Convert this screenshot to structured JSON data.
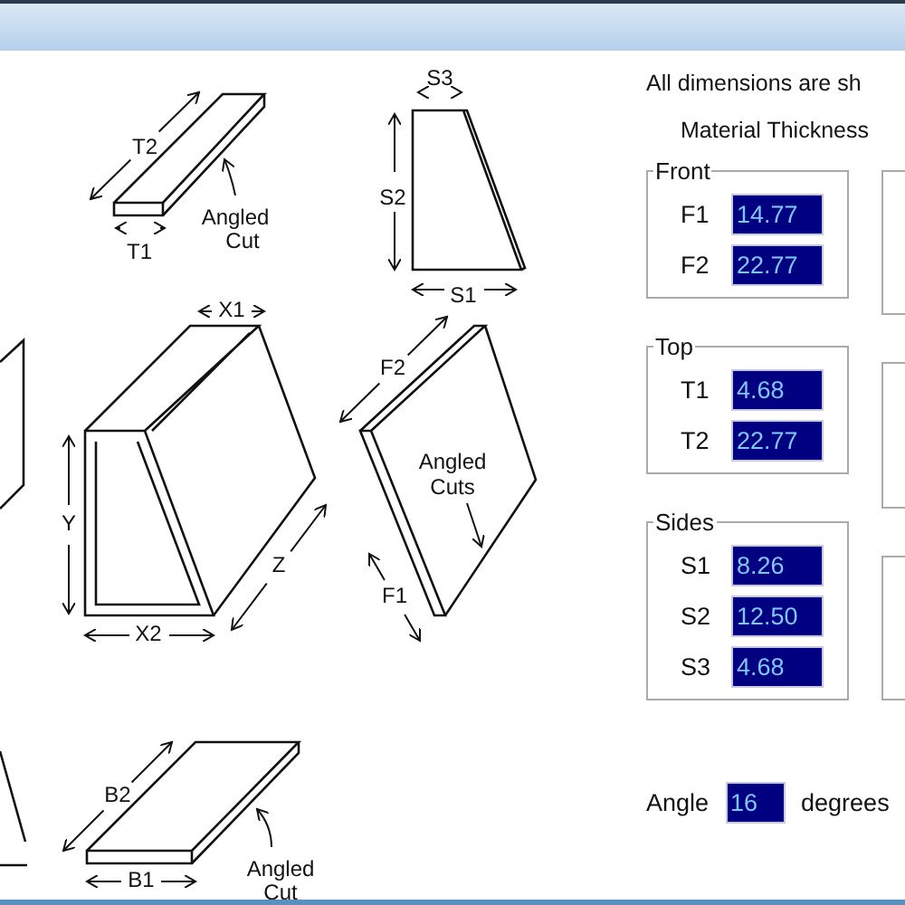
{
  "diagram": {
    "labels": [
      {
        "text": "T2"
      },
      {
        "text": "T1"
      },
      {
        "text": "Angled"
      },
      {
        "text": "Cut"
      },
      {
        "text": "S3"
      },
      {
        "text": "S2"
      },
      {
        "text": "S1"
      },
      {
        "text": "X1"
      },
      {
        "text": "Y"
      },
      {
        "text": "Z"
      },
      {
        "text": "X2"
      },
      {
        "text": "F2"
      },
      {
        "text": "Angled"
      },
      {
        "text": "Cuts"
      },
      {
        "text": "F1"
      },
      {
        "text": "B2"
      },
      {
        "text": "B1"
      },
      {
        "text": "Angled"
      },
      {
        "text": "Cut"
      }
    ]
  },
  "panel": {
    "note": "All dimensions are sh",
    "subheading": "Material Thickness",
    "groups": [
      {
        "title": "Front",
        "fields": [
          {
            "label": "F1",
            "value": "14.77"
          },
          {
            "label": "F2",
            "value": "22.77"
          }
        ]
      },
      {
        "title": "Top",
        "fields": [
          {
            "label": "T1",
            "value": "4.68"
          },
          {
            "label": "T2",
            "value": "22.77"
          }
        ]
      },
      {
        "title": "Sides",
        "fields": [
          {
            "label": "S1",
            "value": "8.26"
          },
          {
            "label": "S2",
            "value": "12.50"
          },
          {
            "label": "S3",
            "value": "4.68"
          }
        ]
      }
    ],
    "angle": {
      "label": "Angle",
      "value": "16",
      "unit": "degrees"
    }
  }
}
